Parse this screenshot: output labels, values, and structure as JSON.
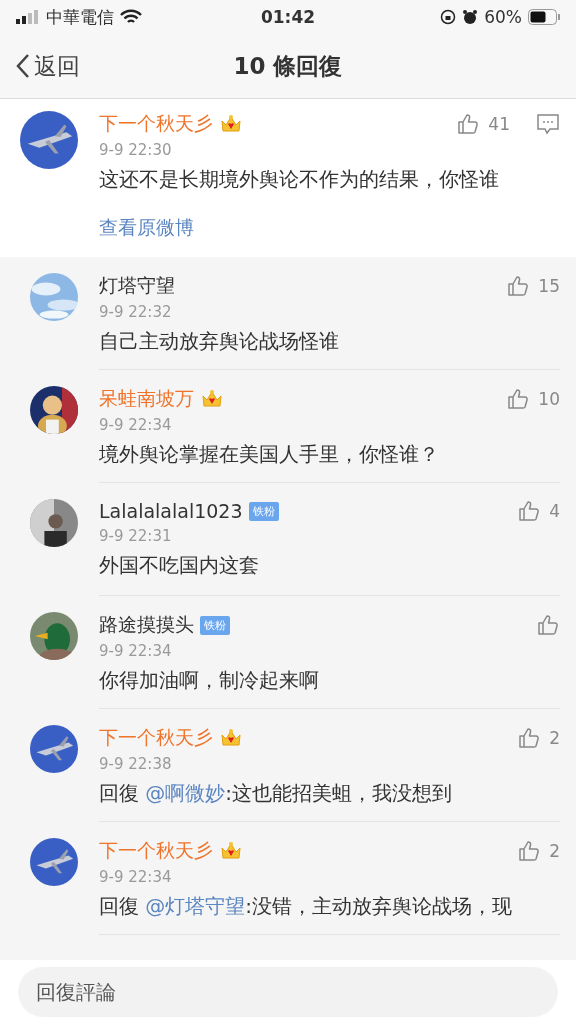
{
  "status_bar": {
    "carrier": "中華電信",
    "time": "01:42",
    "battery": "60%"
  },
  "nav": {
    "back": "返回",
    "title": "10 條回復"
  },
  "main_comment": {
    "name": "下一个秋天彡",
    "vip": true,
    "time": "9-9 22:30",
    "likes": "41",
    "text": "这还不是长期境外舆论不作为的结果，你怪谁",
    "link": "查看原微博"
  },
  "replies": [
    {
      "name": "灯塔守望",
      "vip": false,
      "time": "9-9 22:32",
      "likes": "15",
      "text": "自己主动放弃舆论战场怪谁"
    },
    {
      "name": "呆蛙南坡万",
      "vip": true,
      "time": "9-9 22:34",
      "likes": "10",
      "text": "境外舆论掌握在美国人手里，你怪谁？"
    },
    {
      "name": "Lalalalalal1023",
      "vip": false,
      "badge": "铁粉",
      "time": "9-9 22:31",
      "likes": "4",
      "text": "外国不吃国内这套"
    },
    {
      "name": "路途摸摸头",
      "vip": false,
      "badge": "铁粉",
      "time": "9-9 22:34",
      "text": "你得加油啊，制冷起来啊"
    },
    {
      "name": "下一个秋天彡",
      "vip": true,
      "time": "9-9 22:38",
      "likes": "2",
      "prefix": "回復",
      "mention": "@啊微妙",
      "text": ":这也能招美蛆，我没想到"
    },
    {
      "name": "下一个秋天彡",
      "vip": true,
      "time": "9-9 22:34",
      "likes": "2",
      "prefix": "回復",
      "mention": "@灯塔守望",
      "text": ":没错，主动放弃舆论战场，现"
    }
  ],
  "input": {
    "placeholder": "回復評論"
  }
}
